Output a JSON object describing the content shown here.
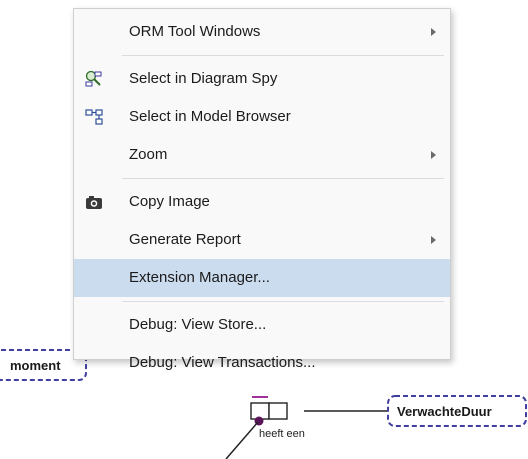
{
  "diagram": {
    "entity_left": "moment",
    "entity_right": "VerwachteDuur",
    "fact_reading": "heeft een"
  },
  "context_menu": {
    "items": [
      {
        "label": "ORM Tool Windows",
        "submenu": true,
        "icon": null
      },
      {
        "separator": true
      },
      {
        "label": "Select in Diagram Spy",
        "submenu": false,
        "icon": "diagram-spy-icon"
      },
      {
        "label": "Select in Model Browser",
        "submenu": false,
        "icon": "model-browser-icon"
      },
      {
        "label": "Zoom",
        "submenu": true,
        "icon": null
      },
      {
        "separator": true
      },
      {
        "label": "Copy Image",
        "submenu": false,
        "icon": "camera-icon"
      },
      {
        "label": "Generate Report",
        "submenu": true,
        "icon": null
      },
      {
        "label": "Extension Manager...",
        "submenu": false,
        "icon": null,
        "highlighted": true
      },
      {
        "separator": true
      },
      {
        "label": "Debug: View Store...",
        "submenu": false,
        "icon": null
      },
      {
        "label": "Debug: View Transactions...",
        "submenu": false,
        "icon": null
      }
    ]
  },
  "colors": {
    "entity_border": "#3f3fa0",
    "highlight": "#ccdcef",
    "uniqueness_bar": "#a0309a",
    "role_connector": "#5a145a"
  }
}
